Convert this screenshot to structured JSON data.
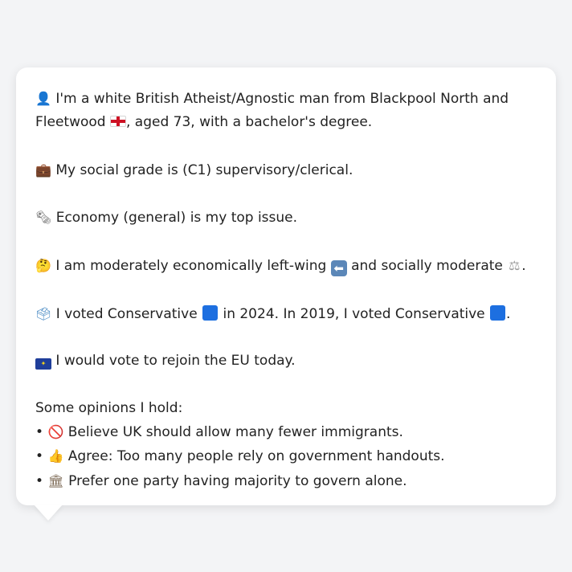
{
  "card": {
    "line1_text_a": "I'm a white British Atheist/Agnostic man from Blackpool North and Fleetwood",
    "line1_text_b": ", aged 73, with a bachelor's degree.",
    "line2_text": "My social grade is (C1) supervisory/clerical.",
    "line3_text": "Economy (general) is my top issue.",
    "line4_text_a": "I am moderately economically left-wing",
    "line4_text_b": "and socially moderate",
    "line4_text_c": ".",
    "line5_text_a": "I voted Conservative",
    "line5_text_b": "in 2024. In 2019, I voted Conservative",
    "line5_text_c": ".",
    "line6_text": "I would vote to rejoin the EU today.",
    "opinions_heading": "Some opinions I hold:",
    "opinions": [
      "Believe UK should allow many fewer immigrants.",
      "Agree: Too many people rely on government handouts.",
      "Prefer one party having majority to govern alone."
    ],
    "bullet": "•"
  },
  "icons": {
    "person": "person-silhouette-icon",
    "england_flag": "england-flag-icon",
    "briefcase": "briefcase-icon",
    "economy": "newspaper-icon",
    "thinking": "thinking-face-icon",
    "left_arrow": "left-arrow-icon",
    "scales": "balance-scale-icon",
    "ballot": "ballot-box-icon",
    "eu_flag": "eu-flag-icon",
    "no_entry": "prohibited-icon",
    "thumbs_up": "thumbs-up-icon",
    "classical_building": "classical-building-icon"
  },
  "colors": {
    "background": "#f3f4f6",
    "card": "#ffffff",
    "text": "#222222",
    "conservative": "#1d6fe0"
  }
}
